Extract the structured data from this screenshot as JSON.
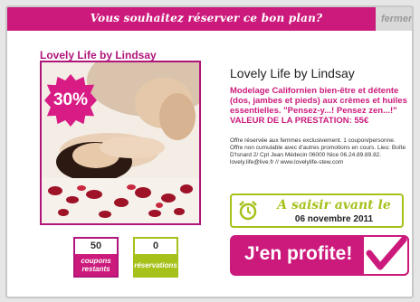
{
  "header": {
    "title": "Vous souhaitez réserver ce bon plan?",
    "close_label": "fermer"
  },
  "deal": {
    "left_title": "Lovely Life by Lindsay",
    "discount": "30%",
    "title": "Lovely Life by Lindsay",
    "description": "Modelage Californien bien-être et détente (dos, jambes et pieds) aux crèmes et huiles essentielles. \"Pensez-y...! Pensez zen...!\" VALEUR DE LA PRESTATION: 55€",
    "conditions": "Offre réservée aux femmes exclusivement. 1 coupon/personne. Offre non cumulable avec d'autres promotions en cours. Lieu: Boîte D'Isnard 2/ Cpt Jean Médecin 06000 Nice 06.24.89.89.82. lovely.life@live.fr // www.lovelylife-stew.com"
  },
  "stats": {
    "coupons": {
      "value": "50",
      "label": "coupons restants"
    },
    "reservations": {
      "value": "0",
      "label": "réservations"
    }
  },
  "deadline": {
    "label": "A saisir avant le",
    "date": "06 novembre 2011",
    "icon": "alarm-clock-icon"
  },
  "cta": {
    "label": "J'en profite!",
    "icon": "checkmark-icon"
  },
  "colors": {
    "magenta": "#cc1a7c",
    "green": "#a6c11a"
  }
}
